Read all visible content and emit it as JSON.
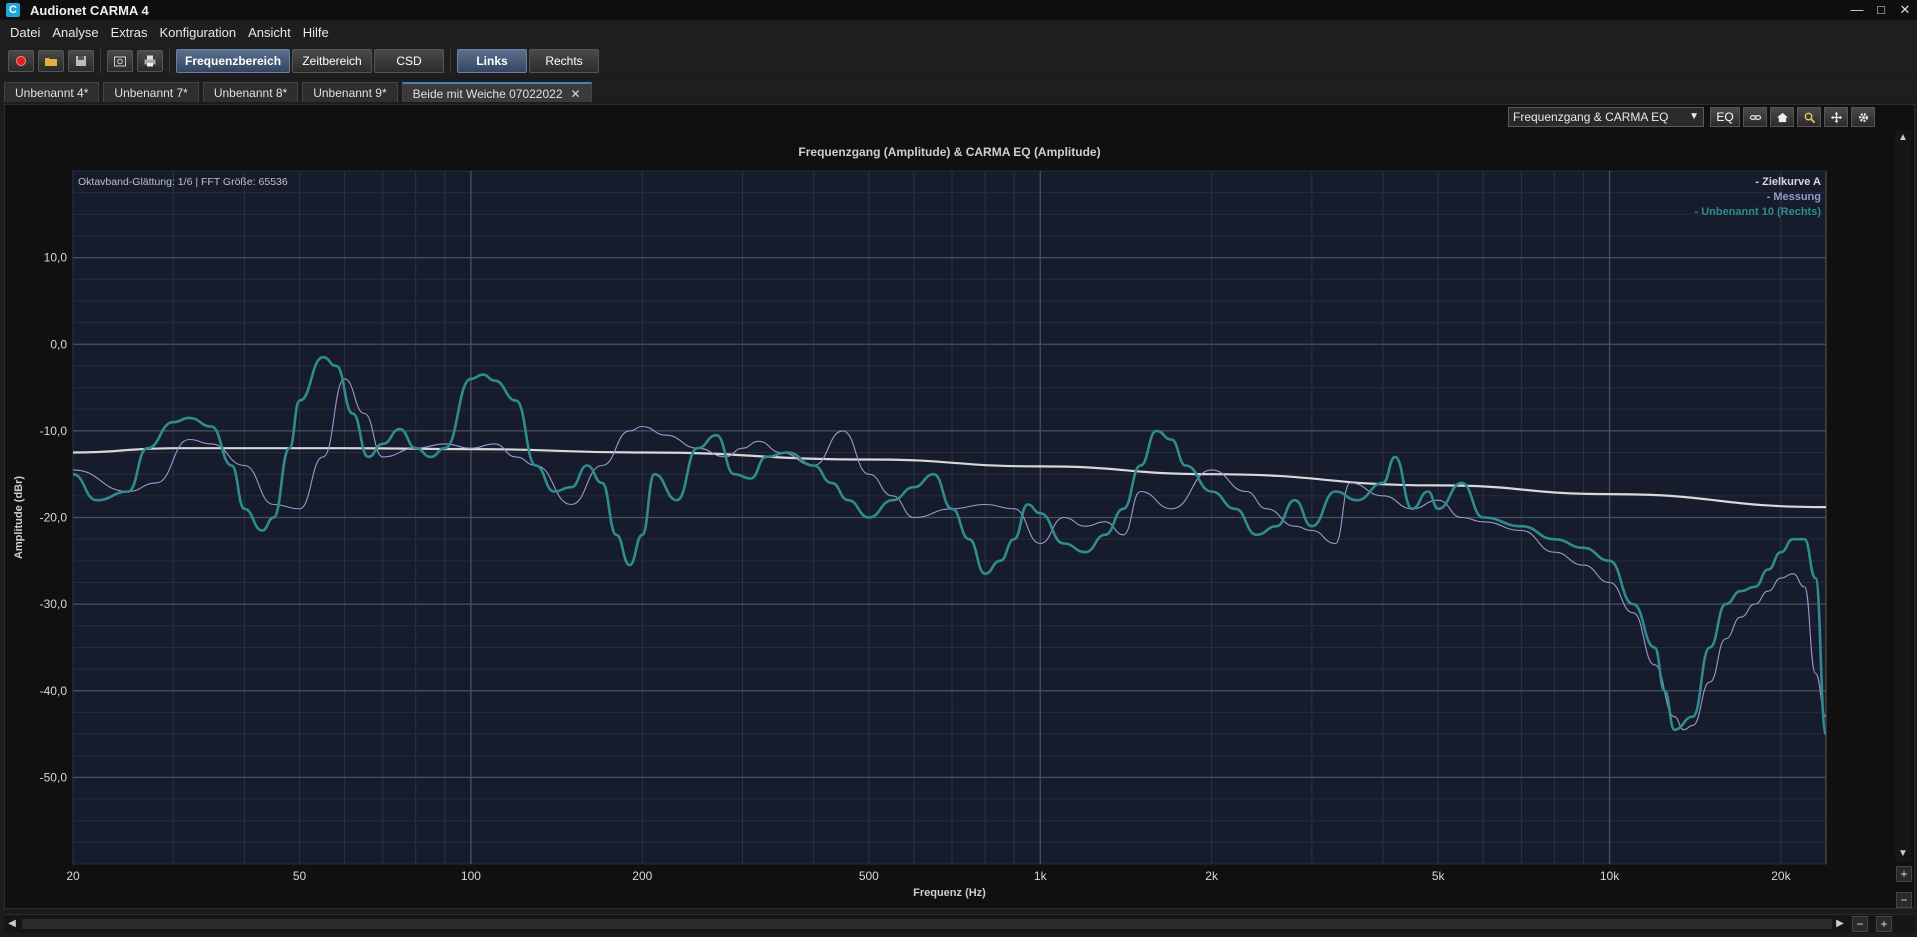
{
  "app": {
    "icon_letter": "C",
    "title": "Audionet CARMA 4",
    "win_min": "—",
    "win_max": "□",
    "win_close": "✕"
  },
  "menu": [
    "Datei",
    "Analyse",
    "Extras",
    "Konfiguration",
    "Ansicht",
    "Hilfe"
  ],
  "toolbar": {
    "icons": [
      "record-icon",
      "open-folder-icon",
      "save-icon",
      "screenshot-icon",
      "print-icon"
    ],
    "modes": [
      "Frequenzbereich",
      "Zeitbereich",
      "CSD"
    ],
    "active_mode": "Frequenzbereich",
    "channels": [
      "Links",
      "Rechts"
    ],
    "active_channel": "Links"
  },
  "tabs": [
    {
      "label": "Unbenannt 4*"
    },
    {
      "label": "Unbenannt 7*"
    },
    {
      "label": "Unbenannt 8*"
    },
    {
      "label": "Unbenannt 9*"
    },
    {
      "label": "Beide mit Weiche 07022022",
      "active": true,
      "close": "✕"
    }
  ],
  "panel_toolbar": {
    "view_select": "Frequenzgang & CARMA EQ",
    "eq_label": "EQ"
  },
  "scroll": {
    "up": "▲",
    "down": "▼",
    "left": "◀",
    "right": "▶",
    "zoom_in": "+",
    "zoom_out": "−"
  },
  "chart_data": {
    "type": "line",
    "title": "Frequenzgang (Amplitude) & CARMA EQ (Amplitude)",
    "subtitle": "Oktavband-Glättung: 1/6 | FFT Größe: 65536",
    "xlabel": "Frequenz (Hz)",
    "ylabel": "Amplitude (dBr)",
    "x_scale": "log",
    "xlim": [
      20,
      24000
    ],
    "ylim": [
      -60,
      20
    ],
    "x_ticks": [
      {
        "value": 20,
        "label": "20"
      },
      {
        "value": 50,
        "label": "50"
      },
      {
        "value": 100,
        "label": "100"
      },
      {
        "value": 200,
        "label": "200"
      },
      {
        "value": 500,
        "label": "500"
      },
      {
        "value": 1000,
        "label": "1k"
      },
      {
        "value": 2000,
        "label": "2k"
      },
      {
        "value": 5000,
        "label": "5k"
      },
      {
        "value": 10000,
        "label": "10k"
      },
      {
        "value": 20000,
        "label": "20k"
      }
    ],
    "y_ticks": [
      {
        "value": 10,
        "label": "10,0"
      },
      {
        "value": 0,
        "label": "0,0"
      },
      {
        "value": -10,
        "label": "-10,0"
      },
      {
        "value": -20,
        "label": "-20,0"
      },
      {
        "value": -30,
        "label": "-30,0"
      },
      {
        "value": -40,
        "label": "-40,0"
      },
      {
        "value": -50,
        "label": "-50,0"
      }
    ],
    "grid": true,
    "legend_position": "top-right",
    "series": [
      {
        "name": "Zielkurve A",
        "legend_label": "- Zielkurve A",
        "color": "#d8d8d8",
        "x": [
          20,
          30,
          60,
          100,
          200,
          500,
          1000,
          2000,
          5000,
          10000,
          24000
        ],
        "y": [
          -12.5,
          -12,
          -12,
          -12.1,
          -12.5,
          -13.3,
          -14.1,
          -15,
          -16.3,
          -17.3,
          -18.8
        ]
      },
      {
        "name": "Messung",
        "legend_label": "- Messung",
        "color": "#9a98d0",
        "x": [
          20,
          25,
          28,
          32,
          35,
          40,
          45,
          50,
          55,
          60,
          65,
          70,
          80,
          90,
          100,
          110,
          120,
          130,
          150,
          170,
          190,
          200,
          220,
          250,
          280,
          300,
          320,
          350,
          400,
          450,
          500,
          550,
          600,
          700,
          800,
          900,
          1000,
          1100,
          1200,
          1300,
          1400,
          1500,
          1700,
          2000,
          2300,
          2500,
          2800,
          3000,
          3300,
          3500,
          4000,
          4500,
          5000,
          5500,
          6000,
          7000,
          8000,
          9000,
          10000,
          11000,
          12000,
          13000,
          13500,
          14000,
          15000,
          16000,
          17000,
          18000,
          19000,
          20000,
          21000,
          22000,
          23000,
          24000
        ],
        "y": [
          -14.5,
          -17,
          -16,
          -11,
          -11.5,
          -14,
          -18.5,
          -19,
          -13,
          -4,
          -8,
          -13,
          -12,
          -11.5,
          -12,
          -11.5,
          -13,
          -14,
          -18.5,
          -14,
          -10,
          -9.5,
          -10.5,
          -12,
          -13,
          -12,
          -11.2,
          -12.5,
          -14,
          -10,
          -15,
          -17.5,
          -20,
          -19,
          -18.5,
          -19,
          -23,
          -20,
          -21,
          -20.5,
          -22,
          -17,
          -19,
          -14.5,
          -17,
          -19,
          -21,
          -21.5,
          -23,
          -16,
          -17.5,
          -19,
          -18,
          -20,
          -20.5,
          -21.5,
          -24,
          -25.5,
          -27.5,
          -31,
          -37,
          -43,
          -44.5,
          -44,
          -39,
          -34,
          -31.5,
          -30,
          -28.5,
          -27,
          -26.5,
          -28,
          -38,
          -43
        ]
      },
      {
        "name": "Unbenannt 10 (Rechts)",
        "legend_label": "- Unbenannt 10 (Rechts)",
        "color": "#2e8c8c",
        "x": [
          20,
          22,
          25,
          27,
          30,
          32,
          35,
          38,
          40,
          43,
          45,
          48,
          50,
          55,
          58,
          62,
          66,
          70,
          75,
          80,
          85,
          90,
          100,
          105,
          110,
          120,
          130,
          140,
          150,
          160,
          170,
          180,
          190,
          200,
          210,
          230,
          250,
          270,
          290,
          310,
          330,
          360,
          400,
          430,
          460,
          500,
          550,
          600,
          650,
          700,
          750,
          800,
          850,
          900,
          950,
          1000,
          1100,
          1200,
          1300,
          1400,
          1500,
          1600,
          1700,
          1800,
          2000,
          2200,
          2400,
          2600,
          2800,
          3000,
          3300,
          3600,
          4000,
          4200,
          4500,
          4800,
          5000,
          5500,
          6000,
          7000,
          8000,
          9000,
          10000,
          11000,
          12000,
          12500,
          13000,
          14000,
          15000,
          16000,
          17000,
          18000,
          19000,
          20000,
          21000,
          22000,
          23000,
          24000
        ],
        "y": [
          -15,
          -18,
          -17,
          -12,
          -9,
          -8.5,
          -9.5,
          -14,
          -19,
          -21.5,
          -20,
          -12,
          -6.5,
          -1.5,
          -2.5,
          -8,
          -13,
          -11.5,
          -9.8,
          -12,
          -13,
          -12,
          -4,
          -3.5,
          -4.2,
          -6.5,
          -14,
          -17,
          -16.5,
          -14,
          -16,
          -22,
          -25.5,
          -22,
          -15,
          -18,
          -12,
          -10.5,
          -15,
          -15.5,
          -13,
          -12.5,
          -14,
          -16,
          -18,
          -20,
          -18,
          -16.5,
          -15,
          -19,
          -22.5,
          -26.5,
          -25,
          -22.5,
          -18.5,
          -19.5,
          -23,
          -24,
          -22,
          -19,
          -14,
          -10,
          -11,
          -14,
          -17,
          -19,
          -22,
          -21,
          -18,
          -21,
          -17,
          -18,
          -16,
          -13,
          -19,
          -17,
          -19,
          -16,
          -20,
          -21,
          -22.5,
          -23.5,
          -25,
          -30,
          -35,
          -40,
          -44.5,
          -43,
          -35,
          -30,
          -28.5,
          -28,
          -26,
          -24,
          -22.5,
          -22.5,
          -27,
          -45
        ]
      }
    ]
  }
}
